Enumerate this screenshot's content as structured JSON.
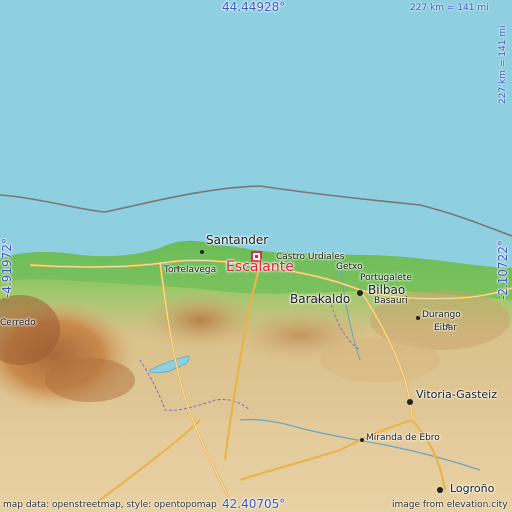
{
  "map": {
    "coords": {
      "top_lat": "44.44928°",
      "bottom_lat": "42.40705°",
      "left_lon": "-4.91972°",
      "right_lon": "-2.10722°"
    },
    "scale": {
      "top": "227 km = 141 mi",
      "right": "227 km = 141 mi"
    },
    "marker": {
      "label": "Escalante",
      "color": "#e0203a"
    },
    "cities": {
      "santander": "Santander",
      "torrelavega": "Torrelavega",
      "castro_urdiales": "Castro Urdiales",
      "getxo": "Getxo",
      "portugalete": "Portugalete",
      "barakaldo": "Barakaldo",
      "bilbao": "Bilbao",
      "basauri": "Basauri",
      "durango": "Durango",
      "eibar": "Eibar",
      "vitoria": "Vitoria-Gasteiz",
      "miranda": "Miranda de Ebro",
      "logrono": "Logroño",
      "cerredo": "Cerredo"
    },
    "attribution": {
      "left": "map data: openstreetmap, style: opentopomap",
      "right": "image from elevation.city"
    },
    "colors": {
      "sea": "#8ecfe0",
      "lowland": "#6fbf5a",
      "highland": "#c98a4e",
      "road": "#e8b54a"
    }
  }
}
